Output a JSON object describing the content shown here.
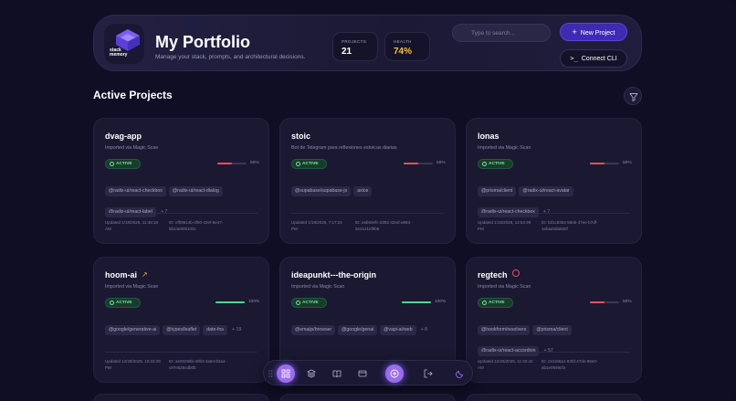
{
  "header": {
    "logo_text_1": "stack",
    "logo_text_2": "memory",
    "title": "My Portfolio",
    "subtitle": "Manage your stack, prompts, and architectural decisions.",
    "stats": [
      {
        "label": "PROJECTS",
        "value": "21"
      },
      {
        "label": "HEALTH",
        "value": "74%"
      }
    ],
    "search_placeholder": "Type to search...",
    "new_project_label": "New Project",
    "connect_cli_label": "Connect CLI"
  },
  "section": {
    "title": "Active Projects"
  },
  "projects": [
    {
      "name": "dvag-app",
      "description": "Imported via Magic Scan",
      "status": "ACTIVE",
      "health": 50,
      "health_label": "50%",
      "tags": [
        "@radix-ui/react-checkbox",
        "@radix-ui/react-dialog",
        "@radix-ui/react-label"
      ],
      "more": "+ 7",
      "updated_1": "Updated 1/18/2026, 11:48:18",
      "updated_2": "AM",
      "id_1": "ID: ef09614b-4f90-42ef-8e47-",
      "id_2": "5b14e805102c"
    },
    {
      "name": "stoic",
      "description": "Bot de Telegram para reflexiones estoicas diarias",
      "status": "ACTIVE",
      "health": 50,
      "health_label": "50%",
      "tags": [
        "@supabase/supabase-js",
        "axios"
      ],
      "more": "",
      "updated_1": "Updated 1/18/2026, 7:17:24",
      "updated_2": "PM",
      "id_1": "ID: eab60efc-d382-42ed-a983-",
      "id_2": "2e2121ef8b8"
    },
    {
      "name": "lonas",
      "description": "Imported via Magic Scan",
      "status": "ACTIVE",
      "health": 50,
      "health_label": "50%",
      "tags": [
        "@prisma/client",
        "@radix-ui/react-avatar",
        "@radix-ui/react-checkbox"
      ],
      "more": "+ 7",
      "updated_1": "Updated 1/15/2026, 12:54:49",
      "updated_2": "PM",
      "id_1": "ID: bd1c8354-58eb-47ee-b7df-",
      "id_2": "1ebad4da550f"
    },
    {
      "name": "hoom-ai",
      "description": "Imported via Magic Scan",
      "status": "ACTIVE",
      "health": 100,
      "health_label": "100%",
      "tags": [
        "@google/generative-ai",
        "@types/leaflet",
        "date-fns"
      ],
      "more": "+ 19",
      "updated_1": "Updated 12/28/2025, 10:22:29",
      "updated_2": "PM",
      "id_1": "ID: ae00298b-40b3-4a84-b2a4-",
      "id_2": "c87e525cdb0b"
    },
    {
      "name": "ideapunkt---the-origin",
      "description": "Imported via Magic Scan",
      "status": "ACTIVE",
      "health": 100,
      "health_label": "100%",
      "tags": [
        "@emaijs/browser",
        "@google/genai",
        "@vapi-ai/web"
      ],
      "more": "+ 8",
      "updated_1": "",
      "updated_2": "",
      "id_1": "",
      "id_2": ""
    },
    {
      "name": "regtech",
      "description": "Imported via Magic Scan",
      "status": "ACTIVE",
      "health": 50,
      "health_label": "50%",
      "tags": [
        "@hookform/resolvers",
        "@prisma/client",
        "@radix-ui/react-accordion"
      ],
      "more": "+ 57",
      "updated_1": "Updated 12/26/2025, 11:40:42",
      "updated_2": "AM",
      "id_1": "ID: c51158a1-83fd-47de-88e0-",
      "id_2": "ab1e0949cfa"
    }
  ],
  "colors": {
    "accent": "#3d2bb3",
    "dock_active": "#9a6cf0",
    "good": "#52d68a",
    "bad": "#e8505e",
    "health": "#f6c142"
  }
}
